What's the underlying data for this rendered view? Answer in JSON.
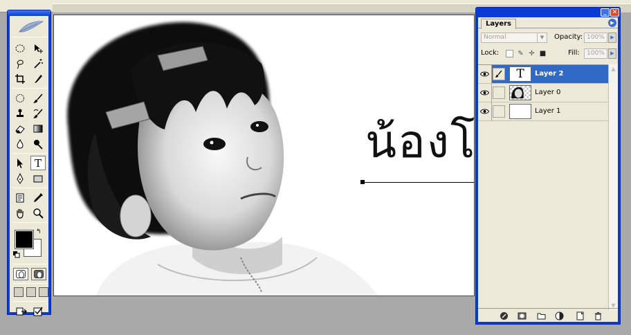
{
  "canvas": {
    "text_layer_content": "น้องโ"
  },
  "tools": {
    "items": [
      "marquee-tool",
      "move-tool",
      "lasso-tool",
      "magic-wand-tool",
      "crop-tool",
      "slice-tool",
      "healing-brush-tool",
      "brush-tool",
      "clone-stamp-tool",
      "history-brush-tool",
      "eraser-tool",
      "gradient-tool",
      "blur-tool",
      "dodge-tool",
      "path-selection-tool",
      "type-tool",
      "pen-tool",
      "shape-tool",
      "notes-tool",
      "eyedropper-tool",
      "hand-tool",
      "zoom-tool"
    ],
    "active_tool": "type-tool",
    "type_tool_glyph": "T",
    "foreground_color": "#000000",
    "background_color": "#ffffff"
  },
  "layers_panel": {
    "tab_label": "Layers",
    "blend_mode": "Normal",
    "opacity_label": "Opacity:",
    "opacity_value": "100%",
    "lock_label": "Lock:",
    "fill_label": "Fill:",
    "fill_value": "100%",
    "layers": [
      {
        "name": "Layer 2",
        "selected": true,
        "thumb": "T"
      },
      {
        "name": "Layer 0",
        "selected": false,
        "thumb": ""
      },
      {
        "name": "Layer 1",
        "selected": false,
        "thumb": ""
      }
    ],
    "colors": {
      "title_bar": "#0a3bd6",
      "selection": "#316ac5",
      "panel_bg": "#ece9d8"
    }
  }
}
